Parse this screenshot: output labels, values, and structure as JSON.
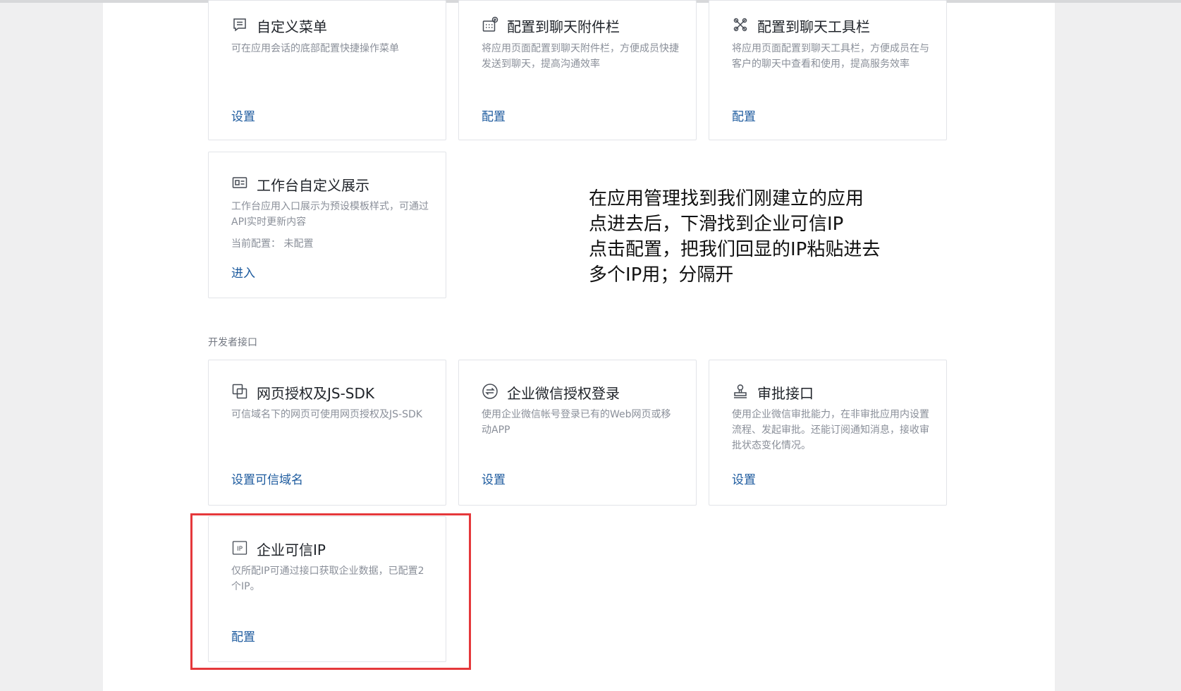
{
  "cards_top": [
    {
      "title": "自定义菜单",
      "icon": "menu-list-icon",
      "desc": "可在应用会话的底部配置快捷操作菜单",
      "link": "设置"
    },
    {
      "title": "配置到聊天附件栏",
      "icon": "attachment-grid-icon",
      "desc": "将应用页面配置到聊天附件栏，方便成员快捷发送到聊天，提高沟通效率",
      "link": "配置"
    },
    {
      "title": "配置到聊天工具栏",
      "icon": "toolbar-icon",
      "desc": "将应用页面配置到聊天工具栏，方便成员在与客户的聊天中查看和使用，提高服务效率",
      "link": "配置"
    }
  ],
  "workbench": {
    "title": "工作台自定义展示",
    "icon": "workbench-card-icon",
    "desc": "工作台应用入口展示为预设模板样式，可通过API实时更新内容",
    "config_label": "当前配置：",
    "config_value": "未配置",
    "link": "进入"
  },
  "annotation": {
    "lines": [
      "在应用管理找到我们刚建立的应用",
      "点进去后，下滑找到企业可信IP",
      "点击配置，把我们回显的IP粘贴进去",
      "多个IP用；分隔开"
    ],
    "highlight_color": "#e5383b"
  },
  "developer": {
    "section_label": "开发者接口",
    "cards": [
      {
        "title": "网页授权及JS-SDK",
        "icon": "web-auth-icon",
        "desc": "可信域名下的网页可使用网页授权及JS-SDK",
        "link": "设置可信域名"
      },
      {
        "title": "企业微信授权登录",
        "icon": "wecom-login-icon",
        "desc": "使用企业微信帐号登录已有的Web网页或移动APP",
        "link": "设置"
      },
      {
        "title": "审批接口",
        "icon": "approval-stamp-icon",
        "desc": "使用企业微信审批能力，在非审批应用内设置流程、发起审批。还能订阅通知消息，接收审批状态变化情况。",
        "link": "设置"
      }
    ],
    "trusted_ip": {
      "title": "企业可信IP",
      "icon": "ip-icon",
      "icon_text": "IP",
      "desc": "仅所配IP可通过接口获取企业数据，已配置2个IP。",
      "link": "配置"
    }
  },
  "colors": {
    "link": "#1c5a9e",
    "border": "#e2e4e8",
    "page_bg": "#efeff0"
  }
}
